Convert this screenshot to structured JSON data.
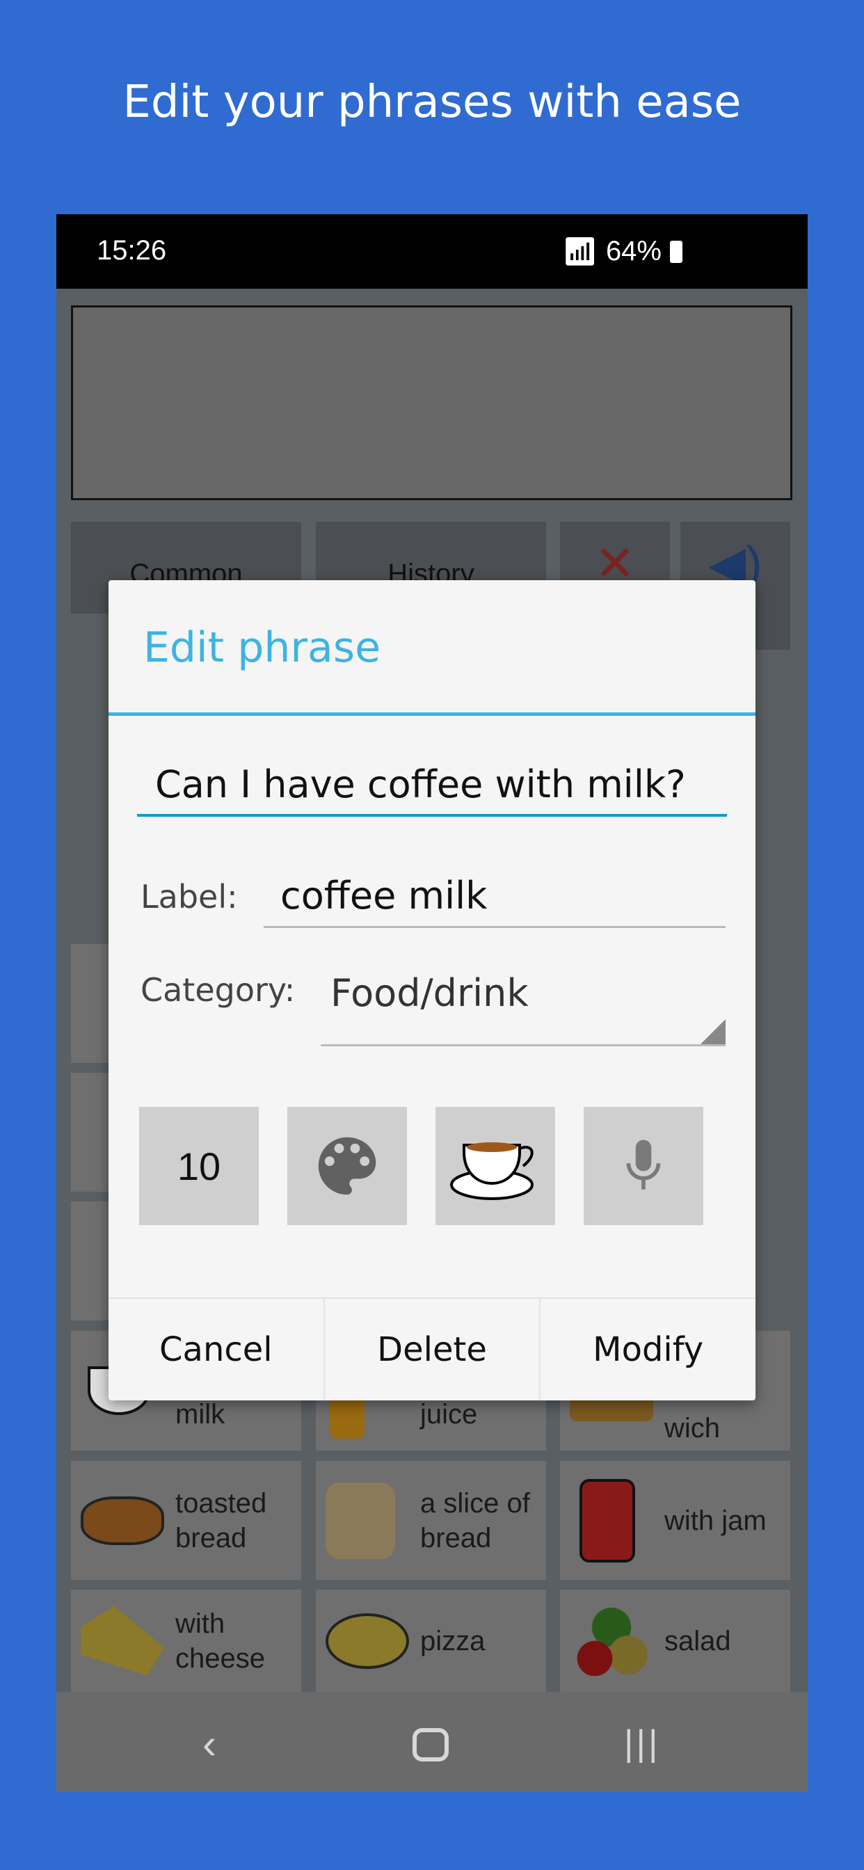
{
  "headline": "Edit your phrases with ease",
  "status": {
    "time": "15:26",
    "battery": "64%"
  },
  "top_buttons": {
    "common": "Common",
    "history": "History"
  },
  "tiles": [
    {
      "label": "milk",
      "icon": "coffee-cup-icon"
    },
    {
      "label": "juice",
      "icon": "juice-glass-icon"
    },
    {
      "label": "wich",
      "icon": "sandwich-icon"
    },
    {
      "label": "toasted bread",
      "icon": "toast-icon"
    },
    {
      "label": "a slice of bread",
      "icon": "bread-icon"
    },
    {
      "label": "with jam",
      "icon": "jam-jar-icon"
    },
    {
      "label": "with cheese",
      "icon": "cheese-icon"
    },
    {
      "label": "pizza",
      "icon": "pizza-icon"
    },
    {
      "label": "salad",
      "icon": "salad-icon"
    }
  ],
  "dialog": {
    "title": "Edit phrase",
    "phrase": "Can I have coffee with milk?",
    "label_caption": "Label:",
    "label_value": "coffee milk",
    "category_caption": "Category:",
    "category_value": "Food/drink",
    "size_value": "10",
    "buttons": {
      "cancel": "Cancel",
      "delete": "Delete",
      "modify": "Modify"
    }
  },
  "colors": {
    "accent": "#3cb4e0",
    "background": "#2f6bd1"
  }
}
